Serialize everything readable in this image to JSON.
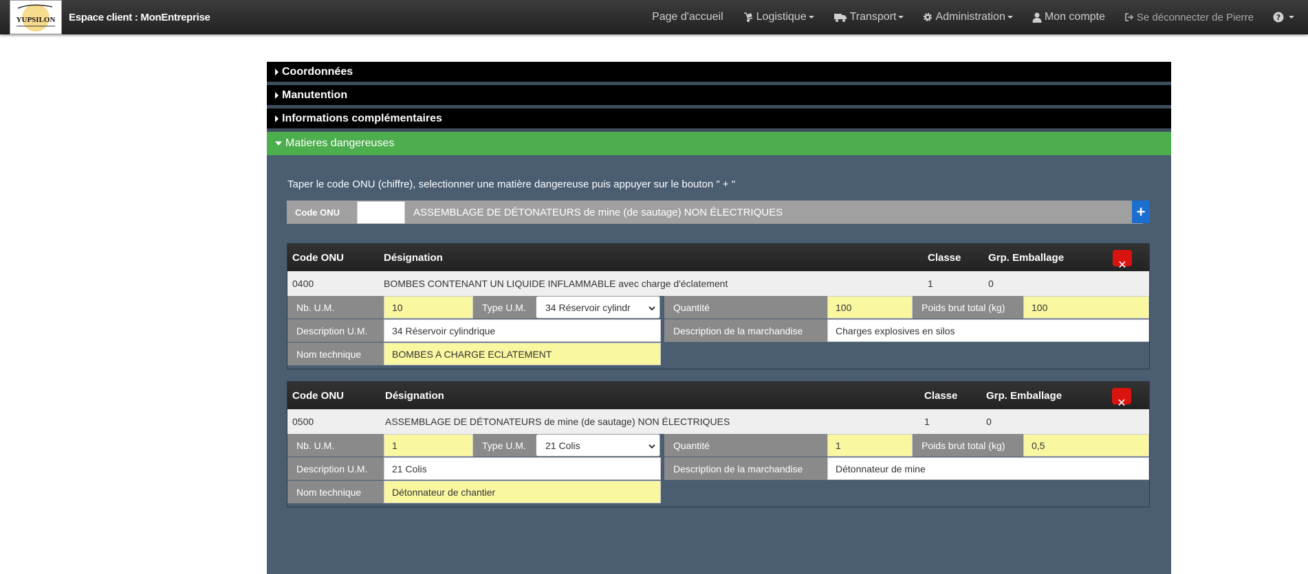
{
  "header": {
    "logo_text": "YUPSILON",
    "brand": "Espace client : MonEntreprise",
    "nav": {
      "home": "Page d'accueil",
      "logistique": "Logistique",
      "transport": "Transport",
      "administration": "Administration",
      "account": "Mon compte",
      "logout": "Se déconnecter de Pierre"
    }
  },
  "accordion": [
    {
      "label": "Coordonnées",
      "open": false
    },
    {
      "label": "Manutention",
      "open": false
    },
    {
      "label": "Informations complémentaires",
      "open": false
    },
    {
      "label": "Matieres dangereuses",
      "open": true
    }
  ],
  "dangerous": {
    "instruction": "Taper le code ONU (chiffre), selectionner une matière dangereuse puis appuyer sur le bouton \" + \"",
    "code_label": "Code ONU",
    "code_value": "",
    "selected_label": "ASSEMBLAGE DE DÉTONATEURS de mine (de sautage) NON ÉLECTRIQUES",
    "add_label": "+",
    "columns": {
      "code": "Code ONU",
      "designation": "Désignation",
      "classe": "Classe",
      "grp": "Grp. Emballage"
    },
    "field_labels": {
      "nb_um": "Nb. U.M.",
      "type_um": "Type U.M.",
      "quantite": "Quantité",
      "poids": "Poids brut total (kg)",
      "desc_um": "Description U.M.",
      "desc_marchandise": "Description de la marchandise",
      "nom_technique": "Nom technique"
    },
    "delete_label": "✕",
    "items": [
      {
        "code": "0400",
        "designation": "BOMBES CONTENANT UN LIQUIDE INFLAMMABLE avec charge d'éclatement",
        "classe": "1",
        "grp": "0",
        "nb_um": "10",
        "type_um": "34 Réservoir cylindr",
        "quantite": "100",
        "poids": "100",
        "desc_um": "34 Réservoir cylindrique",
        "desc_marchandise": "Charges explosives en silos",
        "nom_technique": "BOMBES A CHARGE ECLATEMENT"
      },
      {
        "code": "0500",
        "designation": "ASSEMBLAGE DE DÉTONATEURS de mine (de sautage) NON ÉLECTRIQUES",
        "classe": "1",
        "grp": "0",
        "nb_um": "1",
        "type_um": "21 Colis",
        "quantite": "1",
        "poids": "0,5",
        "desc_um": "21 Colis",
        "desc_marchandise": "Détonnateur de mine",
        "nom_technique": "Détonnateur de chantier"
      }
    ]
  }
}
